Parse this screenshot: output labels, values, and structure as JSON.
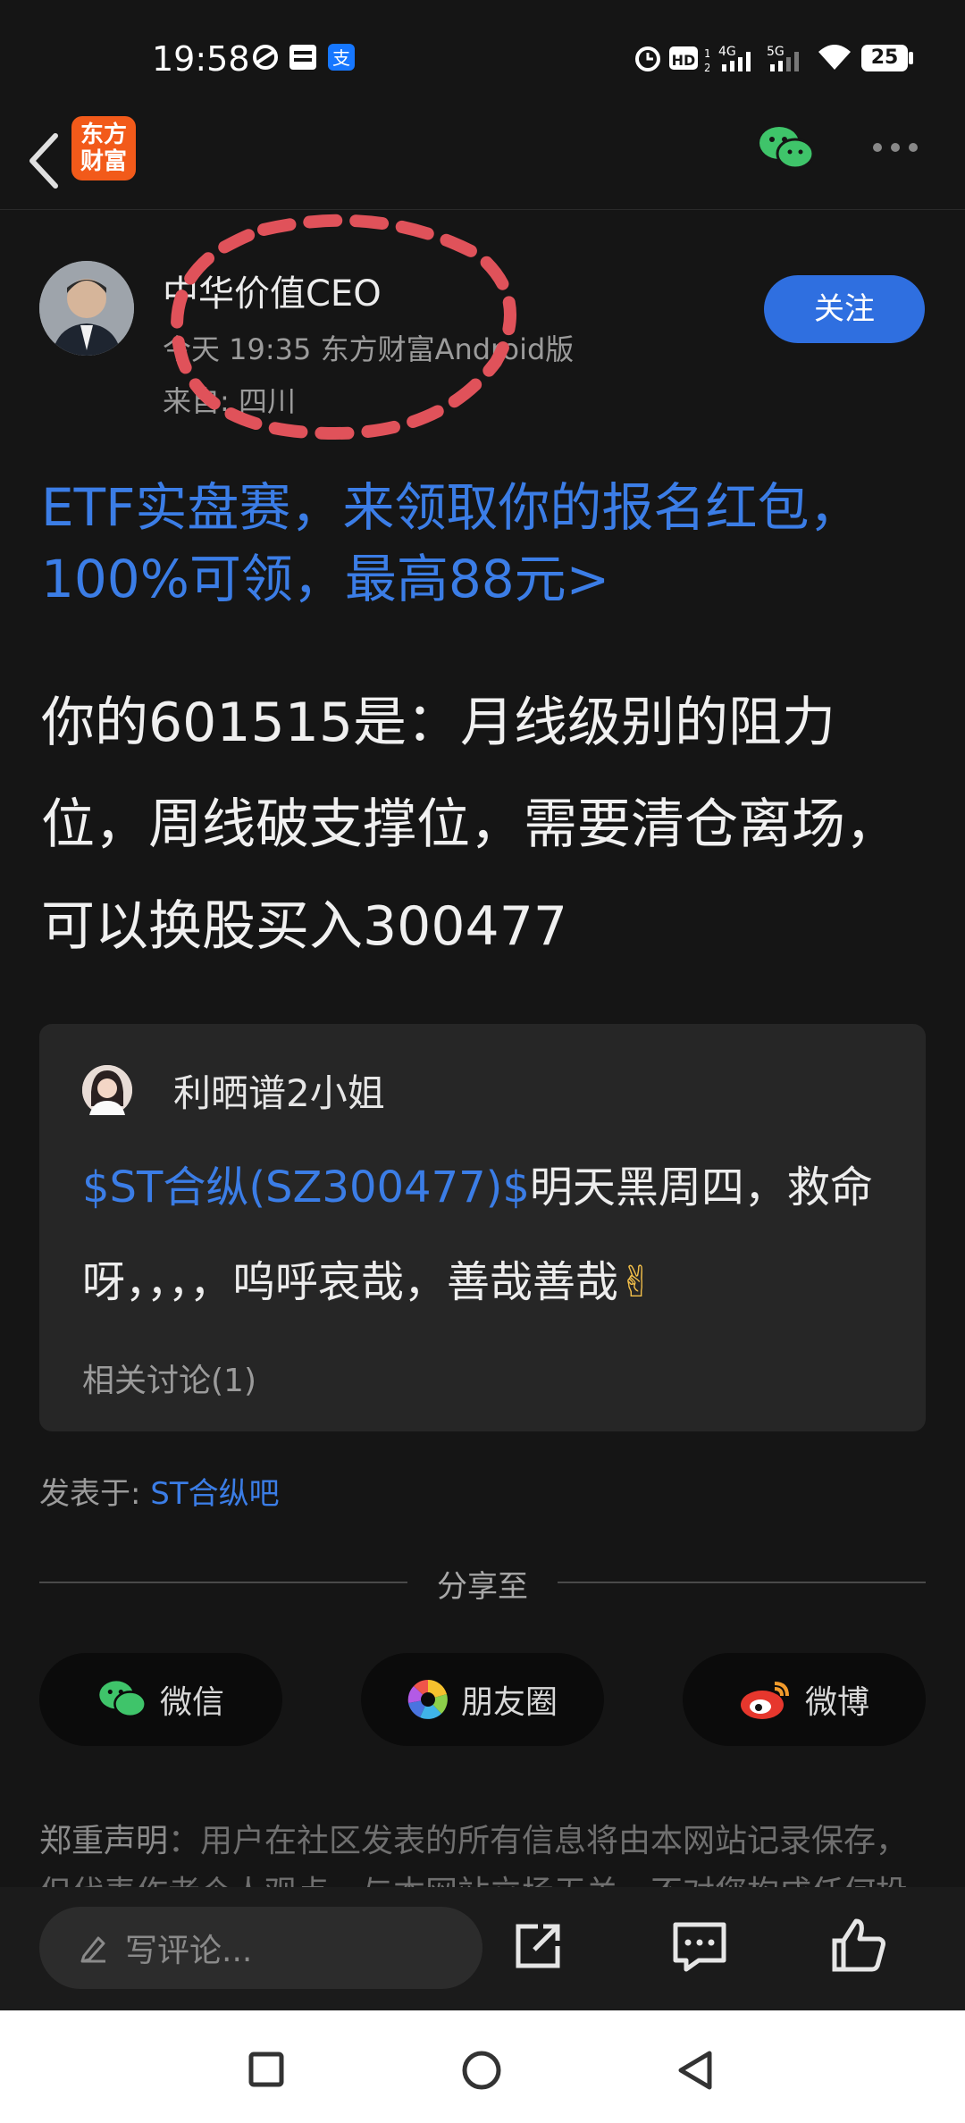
{
  "status_bar": {
    "time": "19:58",
    "battery": "25",
    "icons": [
      "alarm-icon",
      "hd-icon",
      "4g-signal-icon",
      "5g-signal-icon",
      "wifi-icon",
      "battery-icon"
    ]
  },
  "header": {
    "logo_text_line1": "东方",
    "logo_text_line2": "财富"
  },
  "post": {
    "author": "中华价值CEO",
    "meta": "今天 19:35 东方财富Android版",
    "location": "来自: 四川",
    "follow_label": "关注",
    "promo": "ETF实盘赛，来领取你的报名红包，100%可领，最高88元>",
    "body": "你的601515是：月线级别的阻力位，周线破支撑位，需要清仓离场，可以换股买入300477"
  },
  "quoted": {
    "user": "利晒谱2小姐",
    "link": "$ST合纵(SZ300477)$",
    "text": "明天黑周四，救命呀，，，，呜呼哀哉，善哉善哉",
    "emoji": "✌",
    "related": "相关讨论(1)"
  },
  "posted_in": {
    "prefix": "发表于: ",
    "bar": "ST合纵吧"
  },
  "share": {
    "title": "分享至",
    "wechat": "微信",
    "moments": "朋友圈",
    "weibo": "微博"
  },
  "disclaimer": {
    "label": "郑重声明",
    "text": "：用户在社区发表的所有信息将由本网站记录保存，但代表作者个人观点，与本网站立场无关，不对您构成任何投资建议"
  },
  "bottom_bar": {
    "comment_placeholder": "写评论..."
  },
  "colors": {
    "background": "#151515",
    "link_blue": "#3b7de6",
    "follow_button": "#2f6fe0",
    "logo_orange": "#f25a1a",
    "annotation_red": "#e0525a"
  }
}
